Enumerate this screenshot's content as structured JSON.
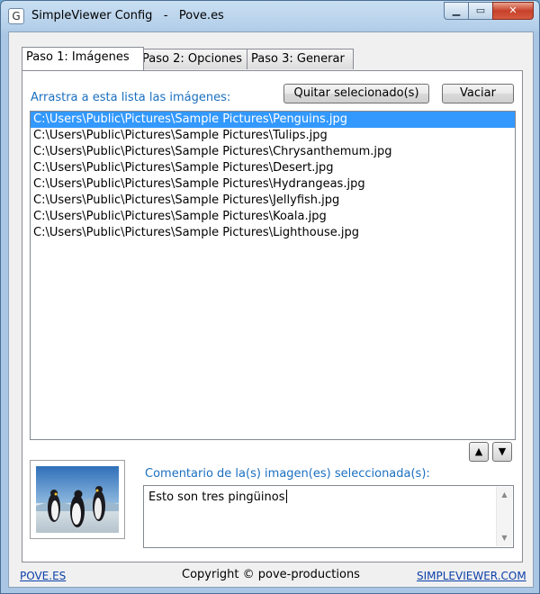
{
  "window": {
    "title": "SimpleViewer Config   -   Pove.es",
    "controls": {
      "minimize": "▁",
      "maximize": "▭",
      "close": "✕"
    }
  },
  "tabs": [
    {
      "label": "Paso 1: Imágenes",
      "active": true
    },
    {
      "label": "Paso 2: Opciones",
      "active": false
    },
    {
      "label": "Paso 3: Generar",
      "active": false
    }
  ],
  "step1": {
    "drag_label": "Arrastra a esta lista las imágenes:",
    "remove_button": "Quitar selecionado(s)",
    "clear_button": "Vaciar",
    "files": [
      {
        "path": "C:\\Users\\Public\\Pictures\\Sample Pictures\\Penguins.jpg",
        "selected": true
      },
      {
        "path": "C:\\Users\\Public\\Pictures\\Sample Pictures\\Tulips.jpg",
        "selected": false
      },
      {
        "path": "C:\\Users\\Public\\Pictures\\Sample Pictures\\Chrysanthemum.jpg",
        "selected": false
      },
      {
        "path": "C:\\Users\\Public\\Pictures\\Sample Pictures\\Desert.jpg",
        "selected": false
      },
      {
        "path": "C:\\Users\\Public\\Pictures\\Sample Pictures\\Hydrangeas.jpg",
        "selected": false
      },
      {
        "path": "C:\\Users\\Public\\Pictures\\Sample Pictures\\Jellyfish.jpg",
        "selected": false
      },
      {
        "path": "C:\\Users\\Public\\Pictures\\Sample Pictures\\Koala.jpg",
        "selected": false
      },
      {
        "path": "C:\\Users\\Public\\Pictures\\Sample Pictures\\Lighthouse.jpg",
        "selected": false
      }
    ],
    "move_up": "▲",
    "move_down": "▼",
    "comment_label": "Comentario de la(s) imagen(es) seleccionada(s):",
    "comment_value": "Esto son tres pingüinos"
  },
  "footer": {
    "left_link": "POVE.ES",
    "copyright": "Copyright © pove-productions",
    "right_link": "SIMPLEVIEWER.COM"
  },
  "colors": {
    "accent_label": "#1a6fc0",
    "selection": "#3399ff",
    "link": "#0b3fa8"
  }
}
